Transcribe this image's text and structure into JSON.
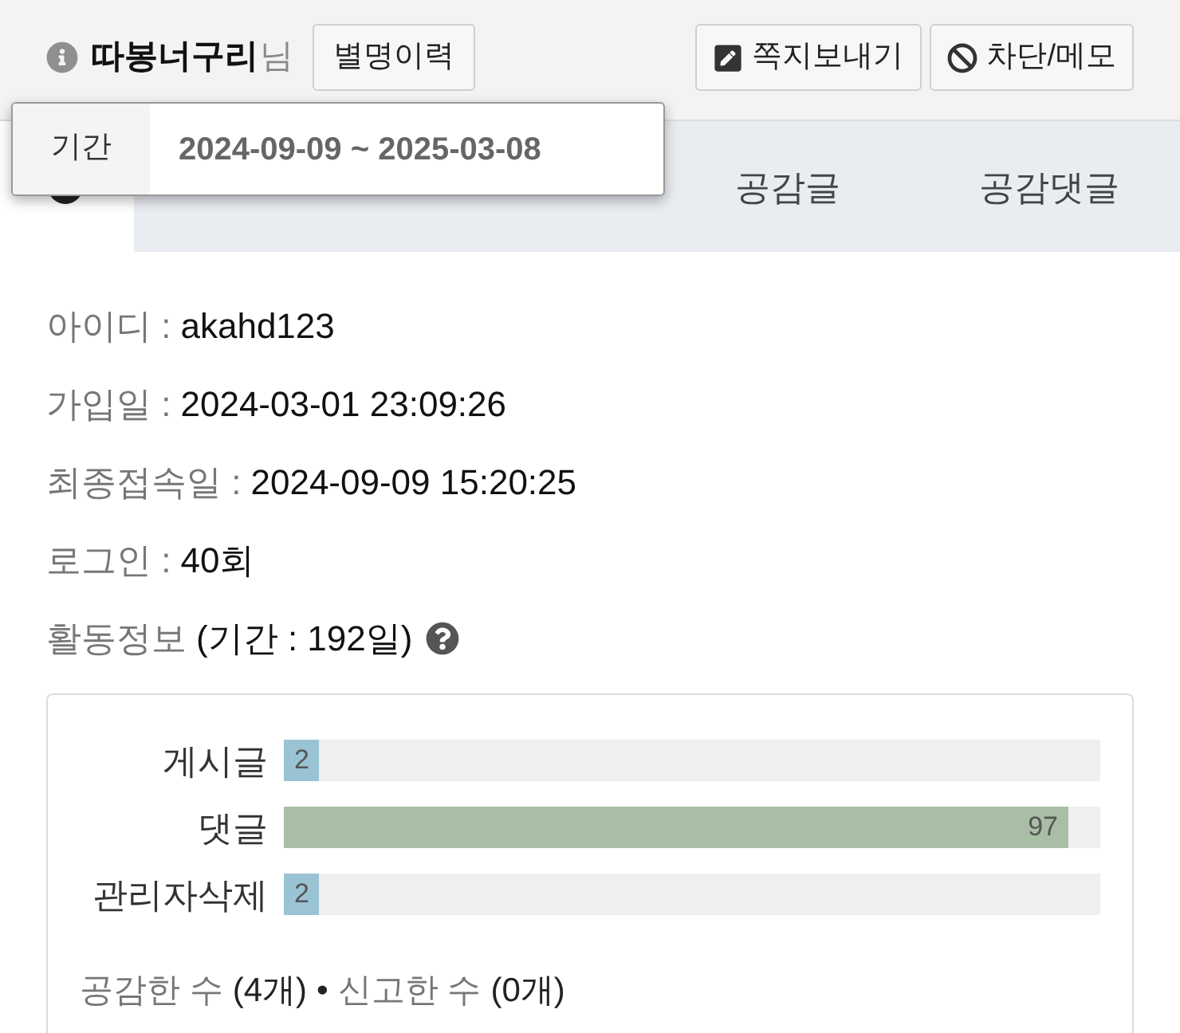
{
  "profile": {
    "name": "따봉너구리",
    "suffix": "님",
    "history_button": "별명이력"
  },
  "actions": [
    {
      "kind": "message",
      "label": "쪽지보내기"
    },
    {
      "kind": "block",
      "label": "차단/메모"
    }
  ],
  "period_popover": {
    "label": "기간",
    "value": "2024-09-09 ~ 2025-03-08"
  },
  "tabs": [
    {
      "label": "공감글"
    },
    {
      "label": "공감댓글"
    }
  ],
  "info": [
    {
      "label": "아이디 :",
      "value": "akahd123"
    },
    {
      "label": "가입일 :",
      "value": "2024-03-01 23:09:26"
    },
    {
      "label": "최종접속일 :",
      "value": "2024-09-09 15:20:25"
    },
    {
      "label": "로그인 :",
      "value": "40회"
    }
  ],
  "activity": {
    "label": "활동정보",
    "period": "(기간 : 192일)"
  },
  "stats": [
    {
      "label": "게시글",
      "value": "2",
      "level": 0.02,
      "color": "#9ac3d4"
    },
    {
      "label": "댓글",
      "value": "97",
      "level": 0.96,
      "color": "#a8bfa5"
    },
    {
      "label": "관리자삭제",
      "value": "2",
      "level": 0.02,
      "color": "#9ac3d4"
    }
  ],
  "summary": {
    "separator": "•",
    "items": [
      {
        "label": "공감한 수",
        "count": "(4개)"
      },
      {
        "label": "신고한 수",
        "count": "(0개)"
      }
    ]
  }
}
